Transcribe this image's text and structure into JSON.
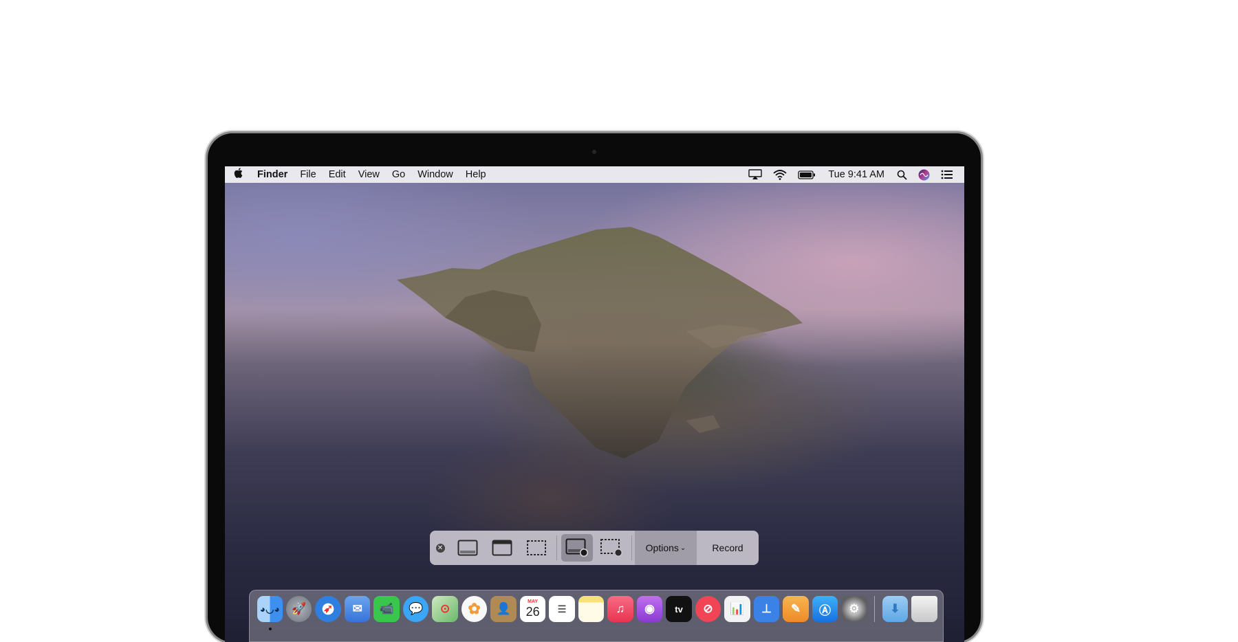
{
  "menubar": {
    "apple_icon": "apple-icon",
    "app_name": "Finder",
    "items": [
      "File",
      "Edit",
      "View",
      "Go",
      "Window",
      "Help"
    ],
    "status_icons": [
      "airplay-icon",
      "wifi-icon",
      "battery-icon"
    ],
    "clock": "Tue 9:41 AM",
    "right_icons": [
      "spotlight-search-icon",
      "siri-icon",
      "notification-center-icon"
    ]
  },
  "screenshot_toolbar": {
    "tools": [
      {
        "name": "capture-entire-screen",
        "icon": "screen-icon",
        "selected": false
      },
      {
        "name": "capture-selected-window",
        "icon": "window-icon",
        "selected": false
      },
      {
        "name": "capture-selected-portion",
        "icon": "dashed-rect-icon",
        "selected": false
      },
      {
        "name": "record-entire-screen",
        "icon": "screen-record-icon",
        "selected": true
      },
      {
        "name": "record-selected-portion",
        "icon": "dashed-record-icon",
        "selected": false
      }
    ],
    "options_label": "Options",
    "record_label": "Record"
  },
  "dock": {
    "apps": [
      {
        "name": "Finder",
        "icon": "finder-icon",
        "color": "#3d8ff0"
      },
      {
        "name": "Launchpad",
        "icon": "launchpad-icon",
        "color": "#8a8f99"
      },
      {
        "name": "Safari",
        "icon": "safari-icon",
        "color": "#2f7fe0"
      },
      {
        "name": "Mail",
        "icon": "mail-icon",
        "color": "#4c8ee6"
      },
      {
        "name": "FaceTime",
        "icon": "facetime-icon",
        "color": "#38c74c"
      },
      {
        "name": "Messages",
        "icon": "messages-icon",
        "color": "#3aa6f5"
      },
      {
        "name": "Maps",
        "icon": "maps-icon",
        "color": "#69b86a"
      },
      {
        "name": "Photos",
        "icon": "photos-icon",
        "color": "#f2f2f2"
      },
      {
        "name": "Contacts",
        "icon": "contacts-icon",
        "color": "#b08a55"
      },
      {
        "name": "Calendar",
        "icon": "calendar-icon",
        "color": "#ffffff",
        "month": "MAY",
        "day": "26"
      },
      {
        "name": "Reminders",
        "icon": "reminders-icon",
        "color": "#ffffff"
      },
      {
        "name": "Notes",
        "icon": "notes-icon",
        "color": "#f7e27a"
      },
      {
        "name": "Music",
        "icon": "music-icon",
        "color": "#f24a6a"
      },
      {
        "name": "Podcasts",
        "icon": "podcasts-icon",
        "color": "#9b4ddb"
      },
      {
        "name": "TV",
        "icon": "apple-tv-icon",
        "color": "#111111",
        "label": "tv"
      },
      {
        "name": "News",
        "icon": "news-icon",
        "color": "#f14555"
      },
      {
        "name": "Numbers",
        "icon": "numbers-icon",
        "color": "#f3f3f3"
      },
      {
        "name": "Keynote",
        "icon": "keynote-icon",
        "color": "#3b82e6"
      },
      {
        "name": "Pages",
        "icon": "pages-icon",
        "color": "#f29c38"
      },
      {
        "name": "App Store",
        "icon": "app-store-icon",
        "color": "#1c8ff0"
      },
      {
        "name": "System Preferences",
        "icon": "system-preferences-icon",
        "color": "#7e7e84"
      }
    ],
    "trailing": [
      {
        "name": "Downloads",
        "icon": "downloads-folder-icon",
        "color": "#79b8ea"
      },
      {
        "name": "Trash",
        "icon": "trash-icon",
        "color": "#dcdcdc"
      }
    ]
  }
}
